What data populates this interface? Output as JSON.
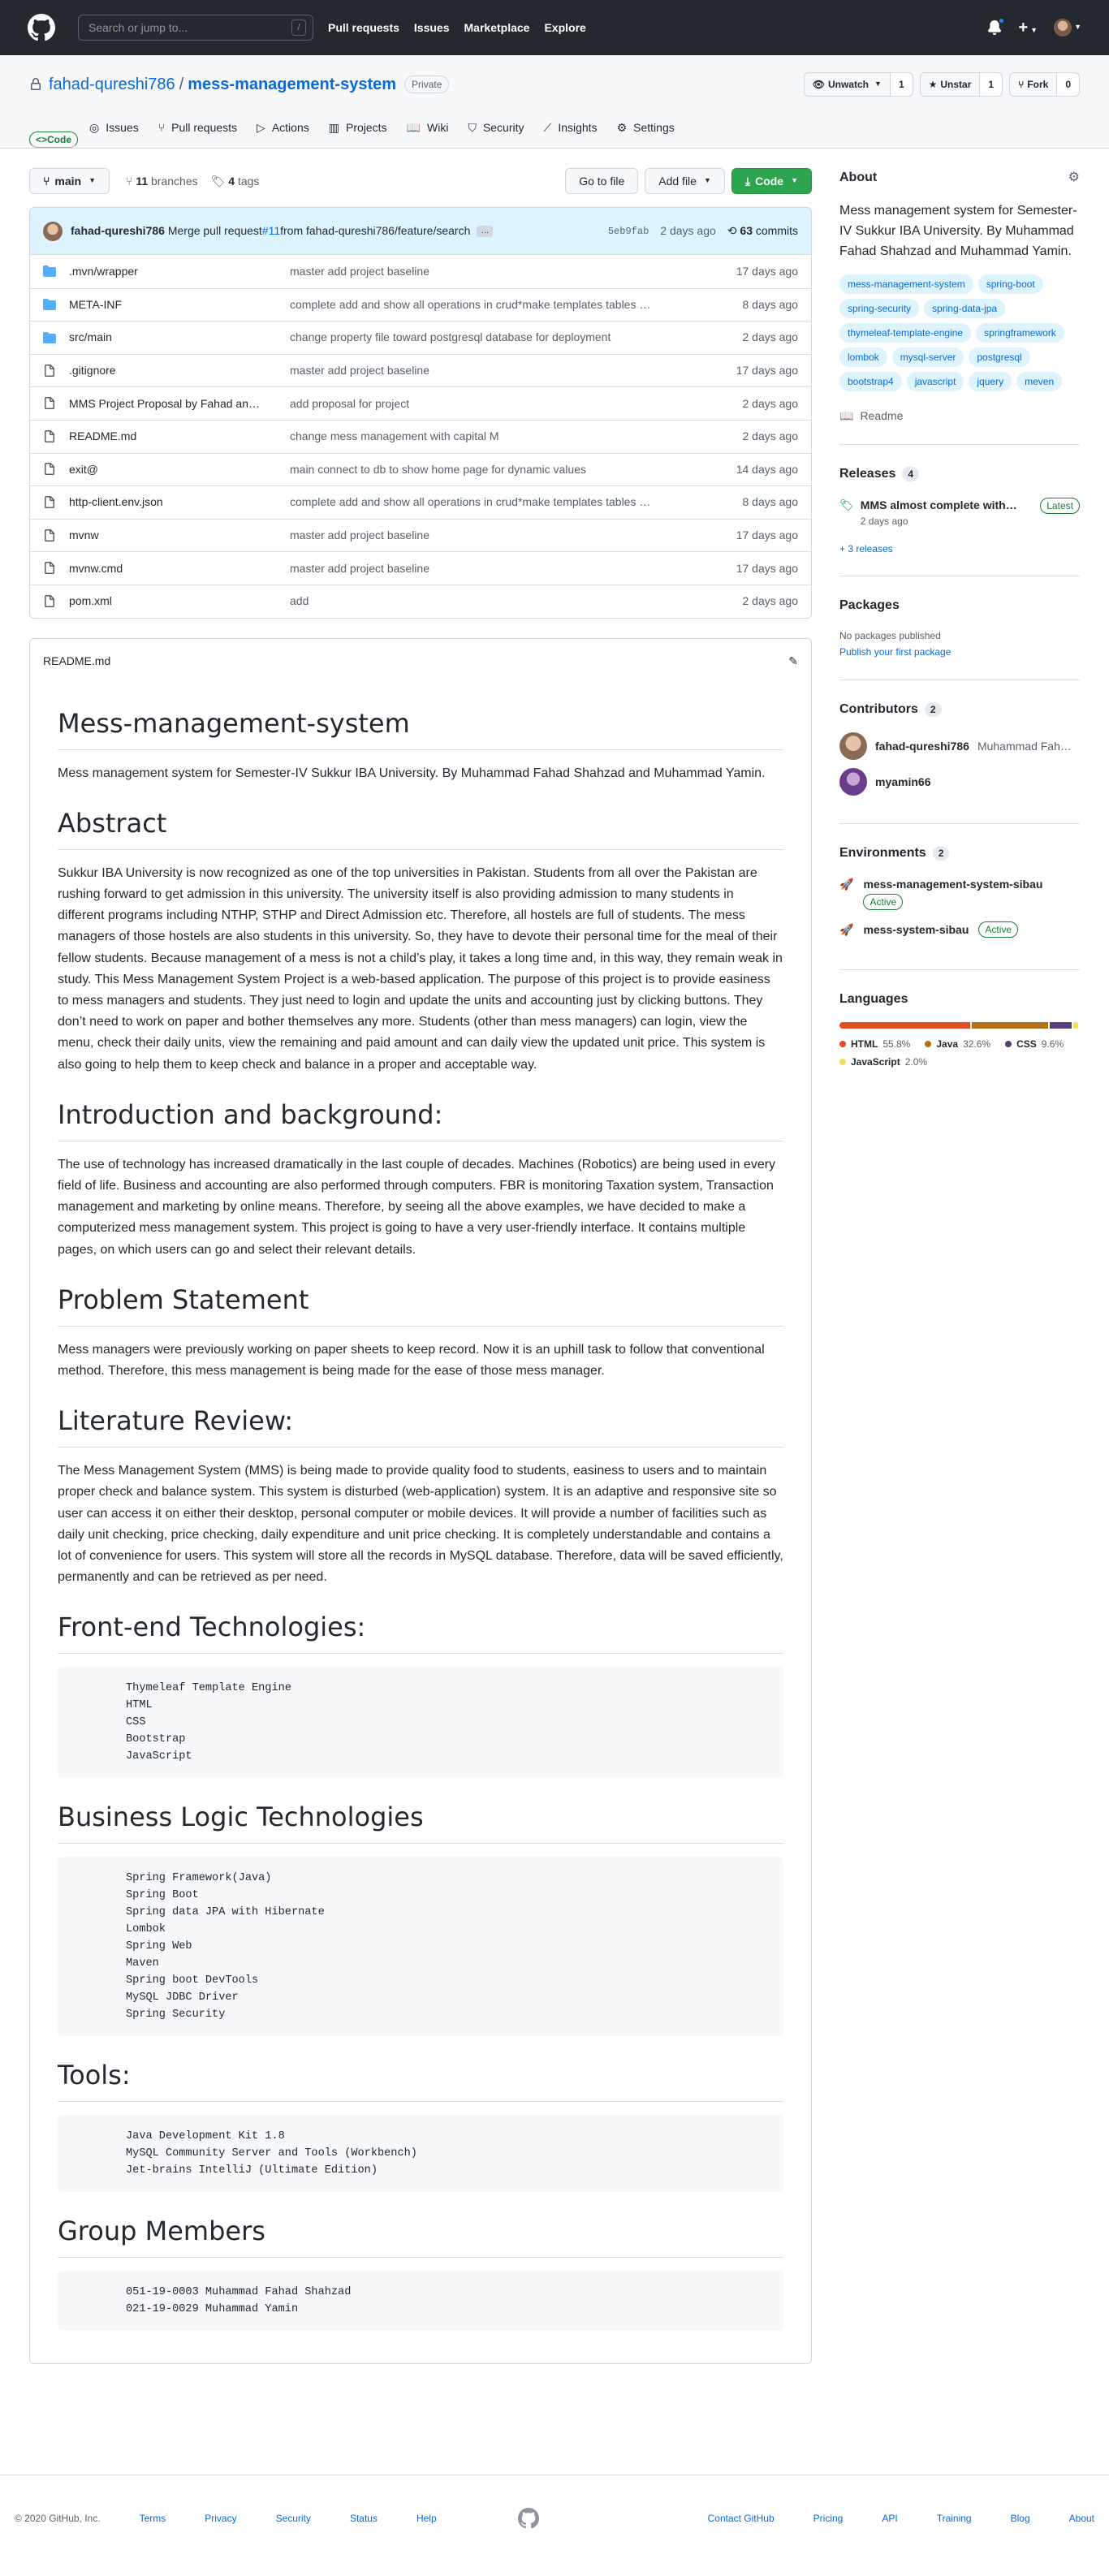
{
  "header": {
    "search_placeholder": "Search or jump to...",
    "slash": "/",
    "nav": [
      "Pull requests",
      "Issues",
      "Marketplace",
      "Explore"
    ]
  },
  "repo": {
    "owner": "fahad-qureshi786",
    "separator": "/",
    "name": "mess-management-system",
    "visibility": "Private",
    "unwatch_label": "Unwatch",
    "watch_count": "1",
    "unstar_label": "Unstar",
    "star_count": "1",
    "fork_label": "Fork",
    "fork_count": "0"
  },
  "tabs": [
    {
      "label": "Code",
      "icon": "code-icon"
    },
    {
      "label": "Issues",
      "icon": "issue-icon"
    },
    {
      "label": "Pull requests",
      "icon": "pull-request-icon"
    },
    {
      "label": "Actions",
      "icon": "play-icon"
    },
    {
      "label": "Projects",
      "icon": "project-icon"
    },
    {
      "label": "Wiki",
      "icon": "book-icon"
    },
    {
      "label": "Security",
      "icon": "shield-icon"
    },
    {
      "label": "Insights",
      "icon": "graph-icon"
    },
    {
      "label": "Settings",
      "icon": "gear-icon"
    }
  ],
  "toolbar": {
    "branch": "main",
    "branches_count": "11",
    "branches_label": "branches",
    "tags_count": "4",
    "tags_label": "tags",
    "go_to_file": "Go to file",
    "add_file": "Add file",
    "code": "Code"
  },
  "commit": {
    "author": "fahad-qureshi786",
    "message_prefix": "Merge pull request ",
    "pr": "#11",
    "message_suffix": " from fahad-qureshi786/feature/search",
    "ellipsis": "…",
    "sha": "5eb9fab",
    "when": "2 days ago",
    "commits_count": "63",
    "commits_label": "commits"
  },
  "files": [
    {
      "type": "dir",
      "name": ".mvn/wrapper",
      "dim": ".mvn/",
      "rest": "wrapper",
      "msg": "master add project baseline",
      "date": "17 days ago"
    },
    {
      "type": "dir",
      "name": "META-INF",
      "msg": "complete add and show all operations in crud*make templates tables …",
      "date": "8 days ago"
    },
    {
      "type": "dir",
      "name": "src/main",
      "dim": "src/",
      "rest": "main",
      "msg": "change property file toward postgresql database for deployment",
      "date": "2 days ago"
    },
    {
      "type": "file",
      "name": ".gitignore",
      "msg": "master add project baseline",
      "date": "17 days ago"
    },
    {
      "type": "file",
      "name": "MMS Project Proposal by Fahad an…",
      "msg": "add proposal for project",
      "date": "2 days ago"
    },
    {
      "type": "file",
      "name": "README.md",
      "msg": "change mess management with capital M",
      "date": "2 days ago"
    },
    {
      "type": "file",
      "name": "exit@",
      "msg": "main connect to db to show home page for dynamic values",
      "date": "14 days ago"
    },
    {
      "type": "file",
      "name": "http-client.env.json",
      "msg": "complete add and show all operations in crud*make templates tables …",
      "date": "8 days ago"
    },
    {
      "type": "file",
      "name": "mvnw",
      "msg": "master add project baseline",
      "date": "17 days ago"
    },
    {
      "type": "file",
      "name": "mvnw.cmd",
      "msg": "master add project baseline",
      "date": "17 days ago"
    },
    {
      "type": "file",
      "name": "pom.xml",
      "msg": "add",
      "date": "2 days ago"
    }
  ],
  "readme": {
    "filename": "README.md",
    "title": "Mess-management-system",
    "intro": "Mess management system for Semester-IV Sukkur IBA University. By Muhammad Fahad Shahzad and Muhammad Yamin.",
    "abstract_h": "Abstract",
    "abstract": "Sukkur IBA University is now recognized as one of the top universities in Pakistan. Students from all over the Pakistan are rushing forward to get admission in this university. The university itself is also providing admission to many students in different programs including NTHP, STHP and Direct Admission etc. Therefore, all hostels are full of students. The mess managers of those hostels are also students in this university. So, they have to devote their personal time for the meal of their fellow students. Because management of a mess is not a child’s play, it takes a long time and, in this way, they remain weak in study. This Mess Management System Project is a web-based application. The purpose of this project is to provide easiness to mess managers and students. They just need to login and update the units and accounting just by clicking buttons. They don’t need to work on paper and bother themselves any more. Students (other than mess managers) can login, view the menu, check their daily units, view the remaining and paid amount and can daily view the updated unit price. This system is also going to help them to keep check and balance in a proper and acceptable way.",
    "intro_bg_h": "Introduction and background:",
    "intro_bg": "The use of technology has increased dramatically in the last couple of decades. Machines (Robotics) are being used in every field of life. Business and accounting are also performed through computers. FBR is monitoring Taxation system, Transaction management and marketing by online means. Therefore, by seeing all the above examples, we have decided to make a computerized mess management system. This project is going to have a very user-friendly interface. It contains multiple pages, on which users can go and select their relevant details.",
    "problem_h": "Problem Statement",
    "problem": "Mess managers were previously working on paper sheets to keep record. Now it is an uphill task to follow that conventional method. Therefore, this mess management is being made for the ease of those mess manager.",
    "lit_h": "Literature Review:",
    "lit": "The Mess Management System (MMS) is being made to provide quality food to students, easiness to users and to maintain proper check and balance system. This system is disturbed (web-application) system. It is an adaptive and responsive site so user can access it on either their desktop, personal computer or mobile devices. It will provide a number of facilities such as daily unit checking, price checking, daily expenditure and unit price checking. It is completely understandable and contains a lot of convenience for users. This system will store all the records in MySQL database. Therefore, data will be saved efficiently, permanently and can be retrieved as per need.",
    "bullet": "",
    "frontend_h": "Front-end Technologies:",
    "frontend": [
      "Thymeleaf Template Engine",
      "HTML",
      "CSS",
      "Bootstrap",
      "JavaScript"
    ],
    "business_h": "Business Logic Technologies",
    "business": [
      "Spring Framework(Java)",
      "Spring Boot",
      "Spring data JPA with Hibernate",
      "Lombok",
      "Spring Web",
      "Maven",
      "Spring boot DevTools",
      "MySQL JDBC Driver",
      "Spring Security"
    ],
    "tools_h": "Tools:",
    "tools": [
      "Java Development Kit 1.8",
      "MySQL Community Server and Tools (Workbench)",
      "Jet-brains IntelliJ (Ultimate Edition)"
    ],
    "group_h": "Group Members",
    "group": [
      "051-19-0003 Muhammad Fahad Shahzad",
      "021-19-0029 Muhammad Yamin"
    ]
  },
  "about": {
    "title": "About",
    "description": "Mess management system for Semester-IV Sukkur IBA University. By Muhammad Fahad Shahzad and Muhammad Yamin.",
    "topics": [
      "mess-management-system",
      "spring-boot",
      "spring-security",
      "spring-data-jpa",
      "thymeleaf-template-engine",
      "springframework",
      "lombok",
      "mysql-server",
      "postgresql",
      "bootstrap4",
      "javascript",
      "jquery",
      "meven"
    ],
    "readme_link": "Readme"
  },
  "releases": {
    "title": "Releases",
    "count": "4",
    "latest_name": "MMS almost complete with…",
    "latest_badge": "Latest",
    "latest_when": "2 days ago",
    "more": "+ 3 releases"
  },
  "packages": {
    "title": "Packages",
    "none": "No packages published",
    "publish": "Publish your first package"
  },
  "contributors": {
    "title": "Contributors",
    "count": "2",
    "list": [
      {
        "login": "fahad-qureshi786",
        "name": "Muhammad Fah…"
      },
      {
        "login": "myamin66",
        "name": ""
      }
    ]
  },
  "environments": {
    "title": "Environments",
    "count": "2",
    "list": [
      {
        "name": "mess-management-system-sibau",
        "status": "Active"
      },
      {
        "name": "mess-system-sibau",
        "status": "Active"
      }
    ]
  },
  "languages": {
    "title": "Languages",
    "list": [
      {
        "name": "HTML",
        "pct": "55.8%",
        "value": 55.8,
        "color": "#e34c26"
      },
      {
        "name": "Java",
        "pct": "32.6%",
        "value": 32.6,
        "color": "#b07219"
      },
      {
        "name": "CSS",
        "pct": "9.6%",
        "value": 9.6,
        "color": "#563d7c"
      },
      {
        "name": "JavaScript",
        "pct": "2.0%",
        "value": 2.0,
        "color": "#f1e05a"
      }
    ]
  },
  "footer": {
    "copyright": "© 2020 GitHub, Inc.",
    "left": [
      "Terms",
      "Privacy",
      "Security",
      "Status",
      "Help"
    ],
    "right": [
      "Contact GitHub",
      "Pricing",
      "API",
      "Training",
      "Blog",
      "About"
    ]
  }
}
